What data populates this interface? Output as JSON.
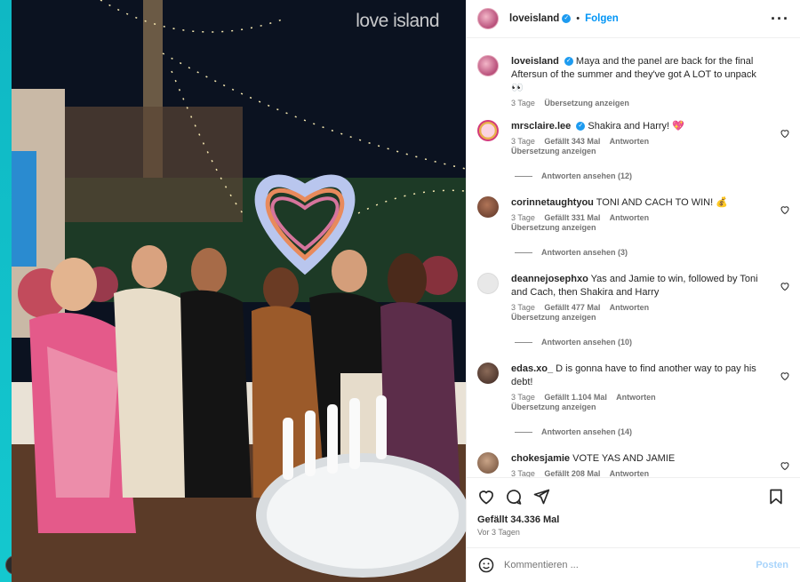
{
  "photo": {
    "watermark": "love island"
  },
  "post": {
    "author": "loveisland",
    "follow_label": "Folgen",
    "caption": {
      "user": "loveisland",
      "text": "Maya and the panel are back for the final Aftersun of the summer and they've got A LOT to unpack 👀",
      "time": "3 Tage",
      "translate": "Übersetzung anzeigen"
    }
  },
  "comments": [
    {
      "user": "mrsclaire.lee",
      "verified": true,
      "text": "Shakira and Harry! 💖",
      "time": "3 Tage",
      "likes": "Gefällt 343 Mal",
      "reply": "Antworten",
      "translate": "Übersetzung anzeigen",
      "view_replies": "Antworten ansehen (12)"
    },
    {
      "user": "corinnetaughtyou",
      "text": "TONI AND CACH TO WIN! 💰",
      "time": "3 Tage",
      "likes": "Gefällt 331 Mal",
      "reply": "Antworten",
      "translate": "Übersetzung anzeigen",
      "view_replies": "Antworten ansehen (3)"
    },
    {
      "user": "deannejosephxo",
      "text": "Yas and Jamie to win, followed by Toni and Cach, then Shakira and Harry",
      "time": "3 Tage",
      "likes": "Gefällt 477 Mal",
      "reply": "Antworten",
      "translate": "Übersetzung anzeigen",
      "view_replies": "Antworten ansehen (10)"
    },
    {
      "user": "edas.xo_",
      "text": "D is gonna have to find another way to pay his debt!",
      "time": "3 Tage",
      "likes": "Gefällt 1.104 Mal",
      "reply": "Antworten",
      "translate": "Übersetzung anzeigen",
      "view_replies": "Antworten ansehen (14)"
    },
    {
      "user": "chokesjamie",
      "text": "VOTE YAS AND JAMIE",
      "time": "3 Tage",
      "likes": "Gefällt 208 Mal",
      "reply": "Antworten"
    }
  ],
  "actions": {
    "likes": "Gefällt 34.336 Mal",
    "date": "Vor 3 Tagen"
  },
  "compose": {
    "placeholder": "Kommentieren ...",
    "post_label": "Posten"
  },
  "colors": {
    "link": "#0095f6",
    "verified": "#1d9bf0",
    "muted": "#737373",
    "strip": "#14c8cf"
  }
}
